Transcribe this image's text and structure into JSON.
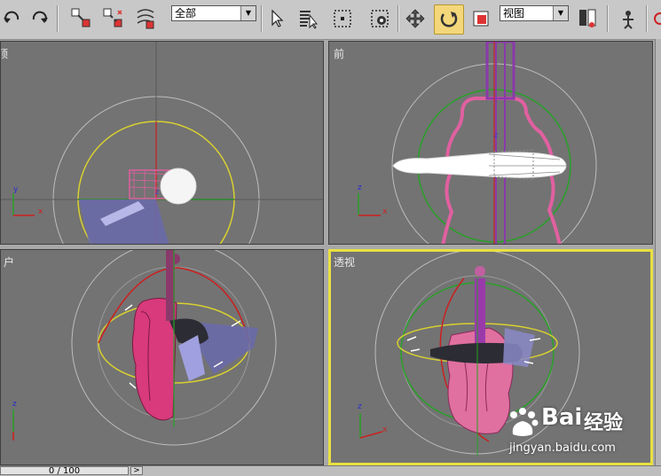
{
  "toolbar": {
    "filter_combo": "全部",
    "coord_combo": "视图",
    "colors": {
      "bg": "#c8c8c8",
      "active": "#f3d77a"
    }
  },
  "viewports": {
    "top_left_label": "顶",
    "top_right_label": "前",
    "bottom_left_label": "户",
    "bottom_right_label": "透视"
  },
  "axes": {
    "x": "x",
    "y": "y",
    "z": "z"
  },
  "timeline": {
    "frame": "0 / 100",
    "next": ">"
  },
  "watermark": {
    "brand": "Bai",
    "brand_cn": "经验",
    "url": "jingyan.baidu.com"
  },
  "icons": [
    "undo-icon",
    "redo-icon",
    "link-icon",
    "unlink-icon",
    "bind-spacewarp-icon",
    "select-icon",
    "select-by-name-icon",
    "rect-region-icon",
    "window-crossing-icon",
    "move-icon",
    "rotate-icon",
    "scale-icon",
    "pivot-icon",
    "mirror-icon"
  ]
}
